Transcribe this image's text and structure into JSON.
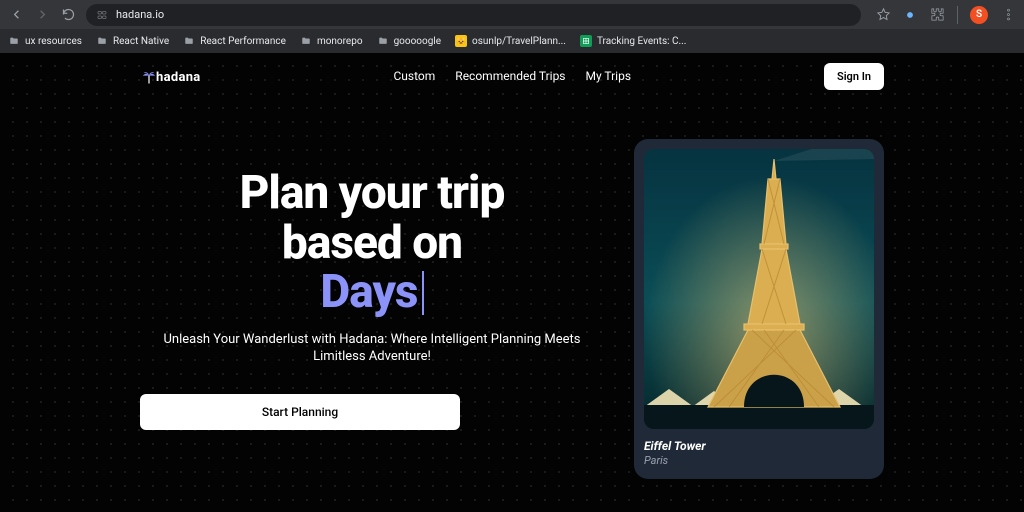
{
  "browser": {
    "url": "hadana.io",
    "avatar_initial": "S",
    "bookmarks": [
      {
        "label": "ux resources",
        "kind": "folder"
      },
      {
        "label": "React Native",
        "kind": "folder"
      },
      {
        "label": "React Performance",
        "kind": "folder"
      },
      {
        "label": "monorepo",
        "kind": "folder"
      },
      {
        "label": "gooooogle",
        "kind": "folder"
      },
      {
        "label": "osunlp/TravelPlann...",
        "kind": "gh"
      },
      {
        "label": "Tracking Events: C...",
        "kind": "sheets"
      }
    ]
  },
  "nav": {
    "brand": "hadana",
    "links": {
      "custom": "Custom",
      "recommended": "Recommended Trips",
      "mytrips": "My Trips"
    },
    "signin": "Sign In"
  },
  "hero": {
    "title_l1": "Plan your trip",
    "title_l2": "based on",
    "dynamic": "Days",
    "subtitle": "Unleash Your Wanderlust with Hadana: Where Intelligent Planning Meets Limitless Adventure!",
    "cta": "Start Planning"
  },
  "card": {
    "title": "Eiffel Tower",
    "subtitle": "Paris"
  }
}
